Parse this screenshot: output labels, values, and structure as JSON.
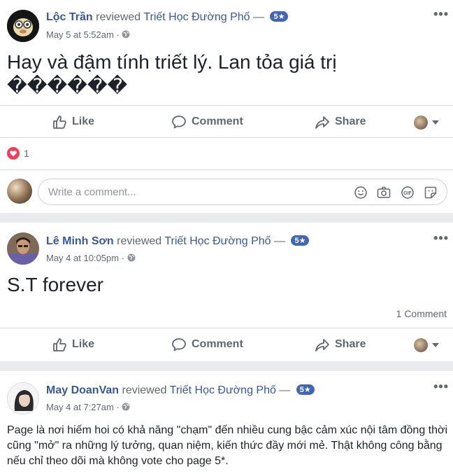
{
  "posts": [
    {
      "author": "Lộc Trần",
      "verb": "reviewed",
      "page": "Triết Học Đường Phố",
      "dash": "—",
      "rating": "5★",
      "time": "May 5 at 5:52am",
      "dot": "·",
      "content": "Hay và đậm tính triết lý. Lan tỏa giá trị ������",
      "reactions_count": "1",
      "comment_placeholder": "Write a comment..."
    },
    {
      "author": "Lê Minh Sơn",
      "verb": "reviewed",
      "page": "Triết Học Đường Phố",
      "dash": "—",
      "rating": "5★",
      "time": "May 4 at 10:05pm",
      "dot": "·",
      "content": "S.T forever",
      "comments_count": "1 Comment"
    },
    {
      "author": "May DoanVan",
      "verb": "reviewed",
      "page": "Triết Học Đường Phố",
      "dash": "—",
      "rating": "5★",
      "time": "May 4 at 7:27am",
      "dot": "·",
      "content": "Page là nơi hiếm hoi có khả năng \"chạm\" đến nhiều cung bậc cảm xúc nội tâm đồng thời cũng \"mở\" ra những lý tưởng, quan niệm, kiến thức đầy mới mẻ. Thật không công bằng nếu chỉ theo dõi mà không vote cho page 5*."
    }
  ],
  "actions": {
    "like": "Like",
    "comment": "Comment",
    "share": "Share"
  },
  "more_icon": "•••",
  "icons": [
    "globe-icon",
    "like-icon",
    "comment-icon",
    "share-icon",
    "love-reaction-icon",
    "emoji-icon",
    "camera-icon",
    "gif-icon",
    "sticker-icon",
    "more-icon"
  ],
  "colors": {
    "link": "#385898",
    "badge": "#4267b2",
    "love": "#f33e58",
    "muted": "#606770"
  }
}
